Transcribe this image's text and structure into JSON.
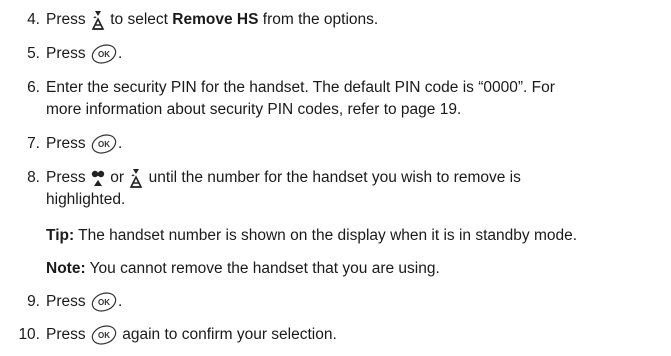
{
  "steps": [
    {
      "num": "4.",
      "before": "Press",
      "bold": "Remove HS",
      "mid": "to select",
      "after": "from the options."
    },
    {
      "num": "5.",
      "before": "Press",
      "after": "."
    },
    {
      "num": "6.",
      "line1": "Enter the security PIN for the handset.  The default PIN code is “0000”. For",
      "line2": "more information about security PIN codes, refer to page 19."
    },
    {
      "num": "7.",
      "before": "Press",
      "after": "."
    },
    {
      "num": "8.",
      "before": "Press",
      "or": "or",
      "after": "until the number for the handset you wish to remove is",
      "line2": "highlighted."
    },
    {
      "num": "9.",
      "before": "Press",
      "after": "."
    },
    {
      "num": "10.",
      "before": "Press",
      "after": "again to confirm your selection."
    }
  ],
  "tip": {
    "label": "Tip:",
    "text": "The handset number is shown on the display when it is in standby mode."
  },
  "note": {
    "label": "Note:",
    "text": "You cannot remove the handset that you are using."
  },
  "icons": {
    "ok": "OK"
  }
}
